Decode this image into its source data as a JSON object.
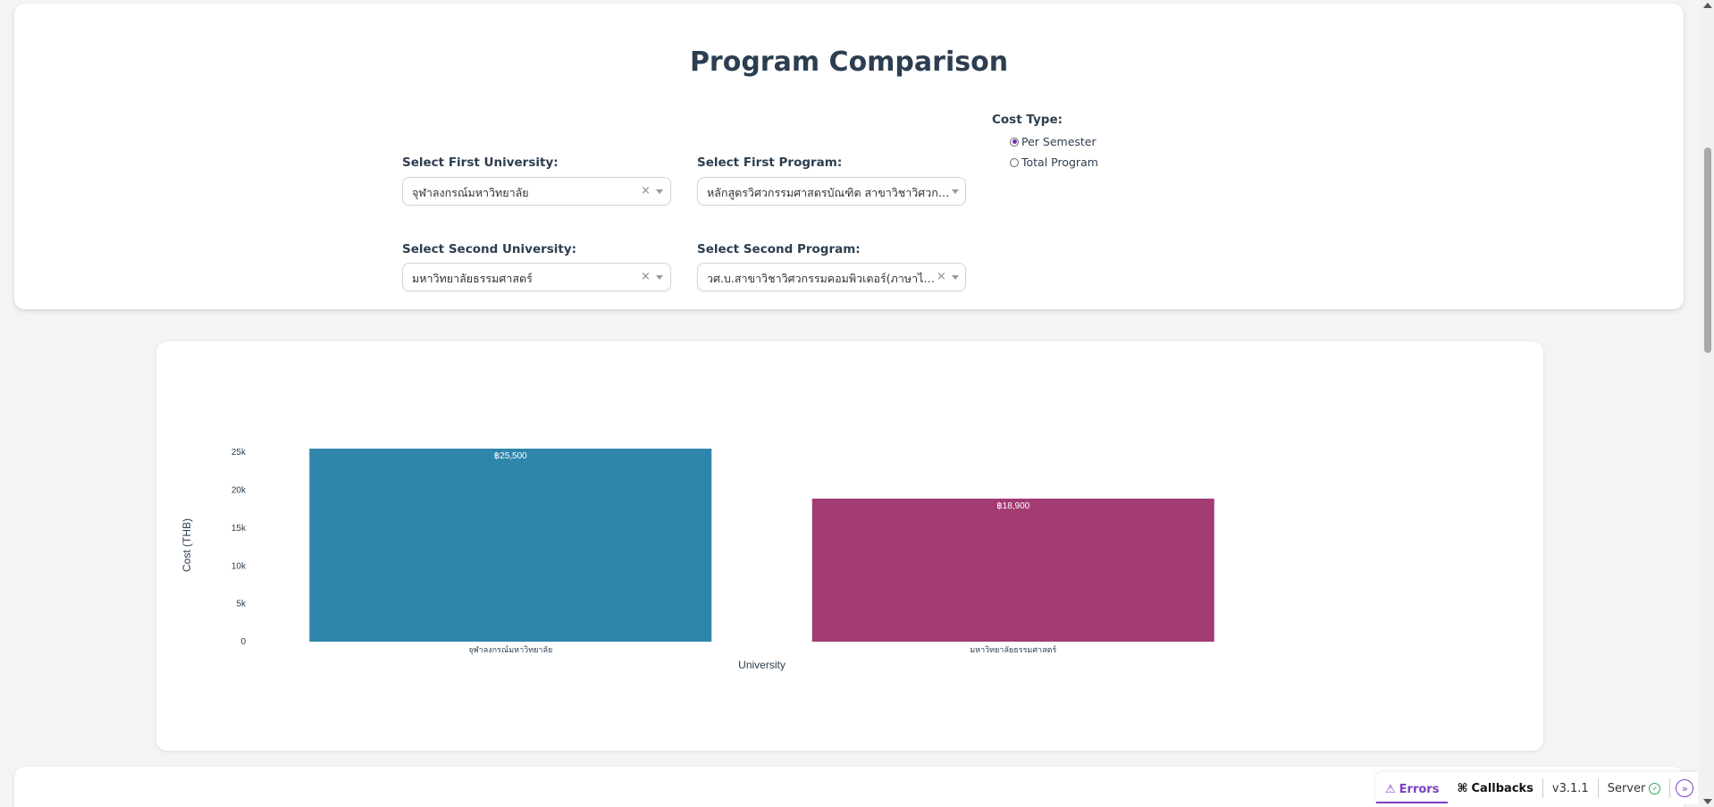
{
  "header": {
    "title": "Program Comparison"
  },
  "selectors": {
    "first_university": {
      "label": "Select First University:",
      "value": "จุฬาลงกรณ์มหาวิทยาลัย"
    },
    "first_program": {
      "label": "Select First Program:",
      "value": "หลักสูตรวิศวกรรมศาสตรบัณฑิต สาขาวิชาวิศวกรร..."
    },
    "second_university": {
      "label": "Select Second University:",
      "value": "มหาวิทยาลัยธรรมศาสตร์"
    },
    "second_program": {
      "label": "Select Second Program:",
      "value": "วศ.บ.สาขาวิชาวิศวกรรมคอมพิวเตอร์(ภาษาไทย..."
    },
    "clear_glyph": "×"
  },
  "cost_type": {
    "label": "Cost Type:",
    "options": [
      "Per Semester",
      "Total Program"
    ],
    "selected": "Per Semester"
  },
  "chart_data": {
    "type": "bar",
    "categories": [
      "จุฬาลงกรณ์มหาวิทยาลัย",
      "มหาวิทยาลัยธรรมศาสตร์"
    ],
    "values": [
      25500,
      18900
    ],
    "value_labels": [
      "฿25,500",
      "฿18,900"
    ],
    "colors": [
      "#2e86ab",
      "#a23b72"
    ],
    "xlabel": "University",
    "ylabel": "Cost (THB)",
    "ylim": [
      0,
      26800
    ],
    "yticks": [
      0,
      5000,
      10000,
      15000,
      20000,
      25000
    ],
    "ytick_labels": [
      "0",
      "5k",
      "10k",
      "15k",
      "20k",
      "25k"
    ],
    "grid": false
  },
  "devtools": {
    "errors_label": "Errors",
    "callbacks_label": "Callbacks",
    "version": "v3.1.1",
    "server_label": "Server"
  },
  "icons": {
    "warning": "warning-icon",
    "callbacks": "callbacks-icon",
    "server_ok": "check-circle-icon",
    "expand": "expand-icon"
  }
}
